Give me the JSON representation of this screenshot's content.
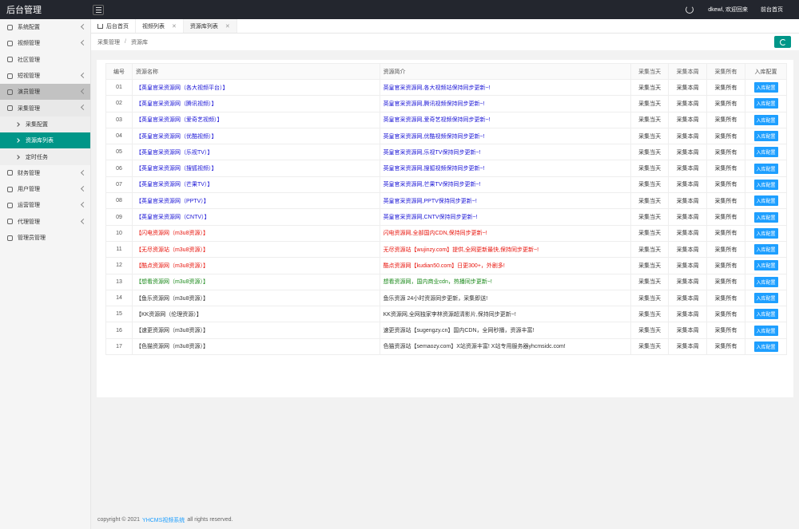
{
  "app": {
    "title": "后台管理"
  },
  "topbar": {
    "user_greeting": "dkewl, 欢迎回来",
    "home_link": "前台首页"
  },
  "sidebar": {
    "items": [
      {
        "label": "系统配置",
        "has_children": true
      },
      {
        "label": "视频管理",
        "has_children": true
      },
      {
        "label": "社区管理",
        "has_children": false
      },
      {
        "label": "短视管理",
        "has_children": true
      },
      {
        "label": "演员管理",
        "has_children": true
      },
      {
        "label": "采集管理",
        "has_children": true
      }
    ],
    "sub_items": [
      "采集配置",
      "资源库列表",
      "定时任务"
    ],
    "items_after": [
      {
        "label": "财务管理",
        "has_children": true
      },
      {
        "label": "用户管理",
        "has_children": true
      },
      {
        "label": "运营管理",
        "has_children": true
      },
      {
        "label": "代理管理",
        "has_children": true
      },
      {
        "label": "管理员管理",
        "has_children": false
      }
    ]
  },
  "tabs": [
    {
      "label": "后台首页",
      "closable": false,
      "active": false
    },
    {
      "label": "视频列表",
      "closable": true,
      "active": false
    },
    {
      "label": "资源库列表",
      "closable": true,
      "active": true
    }
  ],
  "breadcrumb": [
    "采集管理",
    "资源库"
  ],
  "table": {
    "headers": [
      "编号",
      "资源名称",
      "资源简介",
      "采集当天",
      "采集本周",
      "采集所有",
      "入库配置"
    ],
    "rows": [
      {
        "id": "01",
        "name": "【英皇官采资源网（各大视频平台）】",
        "desc": "英皇官采资源网,各大视频站保持同步更新~!",
        "color": "blue"
      },
      {
        "id": "02",
        "name": "【英皇官采资源网（腾讯视频）】",
        "desc": "英皇官采资源网,腾讯视频保持同步更新~!",
        "color": "blue"
      },
      {
        "id": "03",
        "name": "【英皇官采资源网（爱奇艺视频）】",
        "desc": "英皇官采资源网,爱奇艺视频保持同步更新~!",
        "color": "blue"
      },
      {
        "id": "04",
        "name": "【英皇官采资源网（优酷视频）】",
        "desc": "英皇官采资源网,优酷视频保持同步更新~!",
        "color": "blue"
      },
      {
        "id": "05",
        "name": "【英皇官采资源网（乐视TV）】",
        "desc": "英皇官采资源网,乐视TV保持同步更新~!",
        "color": "blue"
      },
      {
        "id": "06",
        "name": "【英皇官采资源网（搜狐视频）】",
        "desc": "英皇官采资源网,搜狐视频保持同步更新~!",
        "color": "blue"
      },
      {
        "id": "07",
        "name": "【英皇官采资源网（芒果TV）】",
        "desc": "英皇官采资源网,芒果TV保持同步更新~!",
        "color": "blue"
      },
      {
        "id": "08",
        "name": "【英皇官采资源网（PPTV）】",
        "desc": "英皇官采资源网,PPTV保持同步更新~!",
        "color": "blue"
      },
      {
        "id": "09",
        "name": "【英皇官采资源网（CNTV）】",
        "desc": "英皇官采资源网,CNTV保持同步更新~!",
        "color": "blue"
      },
      {
        "id": "10",
        "name": "【闪电资源网（m3u8资源）】",
        "desc": "闪电资源网,全部国内CDN,保持同步更新~!",
        "color": "red"
      },
      {
        "id": "11",
        "name": "【无尽资源站（m3u8资源）】",
        "desc": "无尽资源站【wujinzy.com】提供,全网更新最快,保持同步更新~!",
        "color": "red"
      },
      {
        "id": "12",
        "name": "【酷点资源网（m3u8资源）】",
        "desc": "酷点资源网【kudian50.com】日更300+，外剧多!",
        "color": "red"
      },
      {
        "id": "13",
        "name": "【想看资源网（m3u8资源）】",
        "desc": "想看资源网，国内商业cdn，热播同步更新~!",
        "color": "green"
      },
      {
        "id": "14",
        "name": "【鱼乐资源网（m3u8资源）】",
        "desc": "鱼乐资源 24小时资源同步更新，采集即送!",
        "color": "dark"
      },
      {
        "id": "15",
        "name": "【KK资源网（伦理资源）】",
        "desc": "KK资源网,全网独家李林资源超清影片,保持同步更新~!",
        "color": "dark"
      },
      {
        "id": "16",
        "name": "【速更资源网（m3u8资源）】",
        "desc": "速更资源站【sugengzy.cn】国内CDN，全网秒播，资源丰富!",
        "color": "dark"
      },
      {
        "id": "17",
        "name": "【色猫资源网（m3u8资源）】",
        "desc": "色猫资源站【semaozy.com】X站资源丰富!  X站专用服务器yhcmsidc.com!",
        "color": "dark"
      }
    ],
    "action_today": "采集当天",
    "action_week": "采集本周",
    "action_all": "采集所有",
    "config_button": "入库配置"
  },
  "footer": {
    "prefix": "copyright © 2021",
    "link": "YHCMS视频系统",
    "suffix": "all rights reserved."
  },
  "colors": {
    "topbar": "#23262e",
    "accent": "#009688",
    "button": "#1e9fff",
    "blue_text": "#1a14d6",
    "red_text": "#e8140c",
    "green_text": "#1b8a1b"
  }
}
